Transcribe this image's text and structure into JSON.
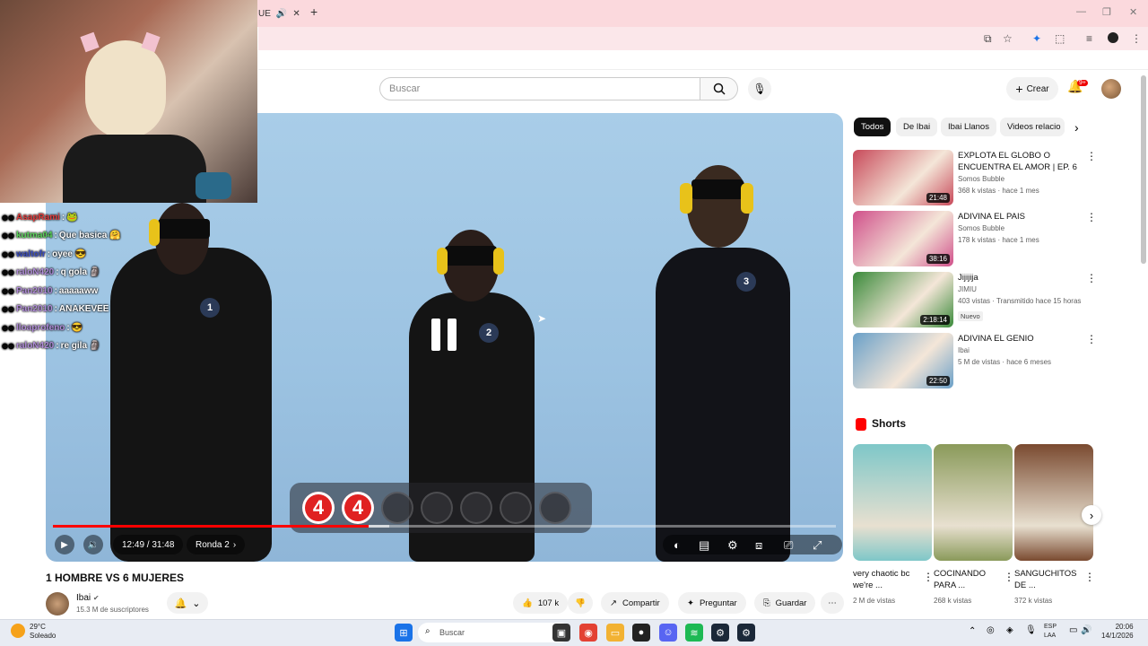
{
  "browser": {
    "tab_fragment": "UE",
    "new_tab": "+",
    "window_controls": [
      "—",
      "❐",
      "✕"
    ]
  },
  "header": {
    "search_placeholder": "Buscar",
    "create_label": "Crear",
    "notifications_badge": "9+"
  },
  "chat": [
    {
      "user": "AsapRami",
      "color": "#e23b3b",
      "sep": " : ",
      "msg": "🐸"
    },
    {
      "user": "kutma04",
      "color": "#5bd35b",
      "sep": ": ",
      "msg": "Que basica 🤗"
    },
    {
      "user": "waltofr",
      "color": "#3b4ec2",
      "sep": " : ",
      "msg": "oyee 😎"
    },
    {
      "user": "raloN420",
      "color": "#b08cd8",
      "sep": " : ",
      "msg": "q gola 🗿"
    },
    {
      "user": "Pan2010",
      "color": "#b08cd8",
      "sep": " : ",
      "msg": "aaaaaww"
    },
    {
      "user": "Pan2010",
      "color": "#b08cd8",
      "sep": " : ",
      "msg": "ANAKEVEE"
    },
    {
      "user": "lloaprofeno",
      "color": "#b08cd8",
      "sep": " : ",
      "msg": "😎"
    },
    {
      "user": "raloN420",
      "color": "#b08cd8",
      "sep": " : ",
      "msg": "re gila 🗿"
    }
  ],
  "player": {
    "time": "12:49 / 31:48",
    "chapter": "Ronda 2",
    "progress": 0.403,
    "buffered": 0.43,
    "score_values": [
      "4",
      "4"
    ],
    "score_total": 7,
    "contestants": [
      "1",
      "2",
      "3"
    ]
  },
  "video": {
    "title": "1 HOMBRE VS 6 MUJERES",
    "channel": "Ibai",
    "subscribers": "15.3 M de suscriptores",
    "likes": "107 k",
    "share": "Compartir",
    "ask": "Preguntar",
    "save": "Guardar"
  },
  "chips": [
    "Todos",
    "De Ibai",
    "Ibai Llanos",
    "Videos relacio"
  ],
  "recommendations": [
    {
      "title": "EXPLOTA EL GLOBO O ENCUENTRA EL AMOR | EP. 6",
      "channel": "Somos Bubble",
      "meta": "368 k vistas · hace 1 mes",
      "duration": "21:48",
      "color": "#c84a5a"
    },
    {
      "title": "ADIVINA EL PAIS",
      "channel": "Somos Bubble",
      "meta": "178 k vistas · hace 1 mes",
      "duration": "38:16",
      "color": "#d0508a"
    },
    {
      "title": "Jijijija",
      "channel": "JIMIU",
      "meta": "403 vistas · Transmitido hace 15 horas",
      "duration": "2:18:14",
      "badge": "Nuevo",
      "color": "#3a8a3a"
    },
    {
      "title": "ADIVINA EL GENIO",
      "channel": "Ibai",
      "meta": "5 M de vistas · hace 6 meses",
      "duration": "22:50",
      "color": "#6aa0c8"
    }
  ],
  "shorts": {
    "heading": "Shorts",
    "items": [
      {
        "title": "very chaotic bc we're ...",
        "meta": "2 M de vistas",
        "color": "#7ec7c8"
      },
      {
        "title": "COCINANDO PARA ...",
        "meta": "268 k vistas",
        "color": "#8a9a5a"
      },
      {
        "title": "SANGUCHITOS DE ...",
        "meta": "372 k vistas",
        "color": "#7a4a30"
      }
    ]
  },
  "taskbar": {
    "search": "Buscar",
    "temperature": "29°C",
    "weather": "Soleado",
    "time": "20:06",
    "date": "14/1/2026",
    "lang1": "ESP",
    "lang2": "LAA"
  }
}
